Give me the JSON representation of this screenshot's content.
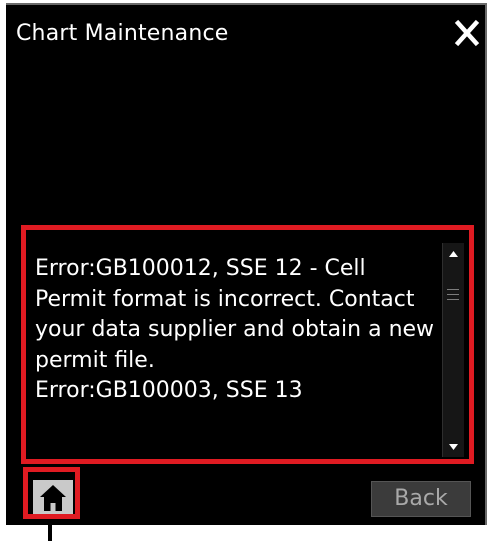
{
  "window": {
    "title": "Chart Maintenance",
    "close_icon": "close-icon"
  },
  "message_list": {
    "entries": [
      "Error:GB100012, SSE 12 - Cell Permit format is incorrect. Contact your data supplier and obtain a new permit file.",
      "Error:GB100003, SSE 13"
    ]
  },
  "scrollbar": {
    "up_icon": "arrow-up-icon",
    "down_icon": "arrow-down-icon",
    "thumb_icon": "grip-icon"
  },
  "footer": {
    "home_icon": "home-icon",
    "back_label": "Back"
  },
  "colors": {
    "panel_background": "#000000",
    "text": "#ffffff",
    "highlight": "#e01b22",
    "back_button_background": "#3b3b3b",
    "back_button_text": "#a9a9a9",
    "home_button_background": "#c9c9c9"
  }
}
